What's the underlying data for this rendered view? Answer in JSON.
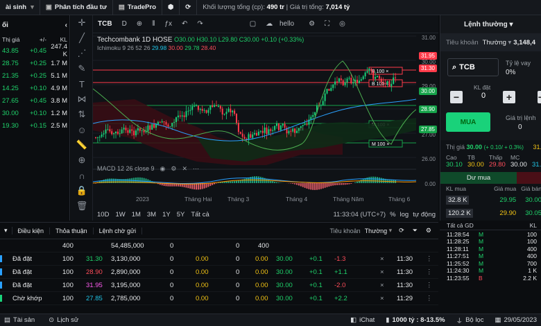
{
  "topbar": {
    "items": [
      "ài sinh",
      "Phân tích đầu tư",
      "TradePro"
    ],
    "volume_label": "Khối lượng tổng (cp):",
    "volume_value": "490 tr",
    "value_label": "| Giá trị tổng:",
    "value_value": "7,014 tỷ"
  },
  "watchlist": {
    "title": "ối",
    "headers": [
      "Thị giá",
      "+/-",
      "KL"
    ],
    "rows": [
      {
        "price": "43.85",
        "chg": "+0.45",
        "vol": "247.4 K",
        "pc": "g",
        "cc": "g"
      },
      {
        "price": "28.75",
        "chg": "+0.25",
        "vol": "1.7 M",
        "pc": "g",
        "cc": "g"
      },
      {
        "price": "21.35",
        "chg": "+0.25",
        "vol": "5.1 M",
        "pc": "g",
        "cc": "g"
      },
      {
        "price": "14.25",
        "chg": "+0.10",
        "vol": "4.9 M",
        "pc": "g",
        "cc": "g"
      },
      {
        "price": "27.65",
        "chg": "+0.45",
        "vol": "3.8 M",
        "pc": "g",
        "cc": "g"
      },
      {
        "price": "30.00",
        "chg": "+0.10",
        "vol": "1.2 M",
        "pc": "g",
        "cc": "g"
      },
      {
        "price": "19.30",
        "chg": "+0.15",
        "vol": "2.5 M",
        "pc": "g",
        "cc": "g"
      }
    ]
  },
  "chart": {
    "symbol": "TCB",
    "interval": "D",
    "hello": "hello",
    "title": "Techcombank  1D  HOSE",
    "ohlc": "O30.00  H30.10  L29.80  C30.00  +0.10 (+0.33%)",
    "ichimoku_label": "Ichimoku 9 26 52 26",
    "ichimoku_vals": [
      "29.98",
      "30.00",
      "29.78",
      "28.40"
    ],
    "macd_label": "MACD 12 26 close 9",
    "y_ticks": [
      "31.00",
      "30.00",
      "29.00",
      "28.00",
      "27.00",
      "26.00"
    ],
    "macd_ticks": [
      "0.00"
    ],
    "price_labels": [
      {
        "text": "31.95",
        "color": "#ff3b4a"
      },
      {
        "text": "31.30",
        "color": "#ff3b4a"
      },
      {
        "text": "30.00",
        "color": "#16a34a"
      },
      {
        "text": "28.90",
        "color": "#16a34a"
      },
      {
        "text": "27.85",
        "color": "#16a34a"
      }
    ],
    "order_lines": [
      {
        "side": "B",
        "qty": "100",
        "color": "#ff3b4a"
      },
      {
        "side": "B",
        "qty": "100",
        "color": "#ff3b4a"
      },
      {
        "side": "M",
        "qty": "100",
        "color": "#16a34a"
      },
      {
        "side": "M",
        "qty": "100",
        "color": "#16a34a"
      }
    ],
    "x_labels": [
      "2023",
      "Tháng Hai",
      "Tháng 3",
      "Tháng 4",
      "Tháng Năm",
      "Tháng 6"
    ],
    "ranges": [
      "10D",
      "1W",
      "1M",
      "3M",
      "1Y",
      "5Y",
      "Tất cả"
    ],
    "time": "11:33:04 (UTC+7)",
    "pct": "%",
    "log": "log",
    "auto": "tự động"
  },
  "order": {
    "mode": "Lệnh thường",
    "account_label": "Tiêu khoản",
    "account_value": "Thường",
    "balance": "3,148,4",
    "symbol_input": "TCB",
    "ratio_label": "Tỷ lệ vay",
    "ratio_value": "0%",
    "qty_label": "KL đặt",
    "qty_value": "0",
    "buy_label": "MUA",
    "order_value_label": "Giá trị lệnh",
    "order_value": "0",
    "market_label": "Thị giá",
    "market_price": "30.00",
    "market_change": "(+ 0.10/ + 0.3%)",
    "ref_labels": [
      "Cao",
      "TB",
      "Thấp",
      "MC"
    ],
    "ref_values": [
      "30.10",
      "30.00",
      "29.80",
      "30.00"
    ],
    "ref_extra": "31.",
    "ref_extra2": "31.",
    "bid_title": "Dư mua",
    "bid_headers": [
      "KL mua",
      "Giá mua",
      "Giá bán"
    ],
    "bids": [
      {
        "vol": "32.8 K",
        "price": "29.95",
        "ask": "30.00"
      },
      {
        "vol": "120.2 K",
        "price": "29.90",
        "ask": "30.05"
      },
      {
        "vol": "69 K",
        "price": "29.85",
        "ask": "30.10"
      }
    ]
  },
  "bottom": {
    "tabs": [
      "Điều kiện",
      "Thỏa thuận",
      "Lệnh chờ gửi"
    ],
    "account_label": "Tiêu khoản",
    "account_value": "Thường",
    "summary": [
      "400",
      "54,485,000",
      "0",
      "0",
      "400"
    ],
    "rows": [
      {
        "status": "Đã đặt",
        "vol": "100",
        "price": "31.30",
        "pcls": "g",
        "value": "3,130,000",
        "m": "0",
        "f": "0.00",
        "fl": "0",
        "cur": "30.00",
        "d": "+0.1",
        "pl": "-1.3",
        "plc": "r",
        "time": "11:30"
      },
      {
        "status": "Đã đặt",
        "vol": "100",
        "price": "28.90",
        "pcls": "r",
        "value": "2,890,000",
        "m": "0",
        "f": "0.00",
        "fl": "0",
        "cur": "30.00",
        "d": "+0.1",
        "pl": "+1.1",
        "plc": "g",
        "time": "11:30"
      },
      {
        "status": "Đã đặt",
        "vol": "100",
        "price": "31.95",
        "pcls": "p",
        "value": "3,195,000",
        "m": "0",
        "f": "0.00",
        "fl": "0",
        "cur": "30.00",
        "d": "+0.1",
        "pl": "-2.0",
        "plc": "r",
        "time": "11:30"
      },
      {
        "status": "Chờ khớp",
        "vol": "100",
        "price": "27.85",
        "pcls": "c",
        "value": "2,785,000",
        "m": "0",
        "f": "0.00",
        "fl": "0",
        "cur": "30.00",
        "d": "+0.1",
        "pl": "+2.2",
        "plc": "g",
        "time": "11:29"
      }
    ]
  },
  "trades": {
    "headers": [
      "Tất cả GD",
      "KL"
    ],
    "rows": [
      {
        "time": "11:28:54",
        "side": "M",
        "vol": "100"
      },
      {
        "time": "11:28:25",
        "side": "M",
        "vol": "100"
      },
      {
        "time": "11:28:11",
        "side": "M",
        "vol": "400"
      },
      {
        "time": "11:27:51",
        "side": "M",
        "vol": "400"
      },
      {
        "time": "11:25:52",
        "side": "M",
        "vol": "700"
      },
      {
        "time": "11:24:30",
        "side": "M",
        "vol": "1 K"
      },
      {
        "time": "11:23:55",
        "side": "B",
        "vol": "2.2 K"
      }
    ]
  },
  "footer": {
    "assets": "Tài sản",
    "history": "Lịch sử",
    "chat": "iChat",
    "lot": "1000 tỷ : 8-13.5%",
    "filter": "Bộ lọc",
    "date": "29/05/2023"
  }
}
